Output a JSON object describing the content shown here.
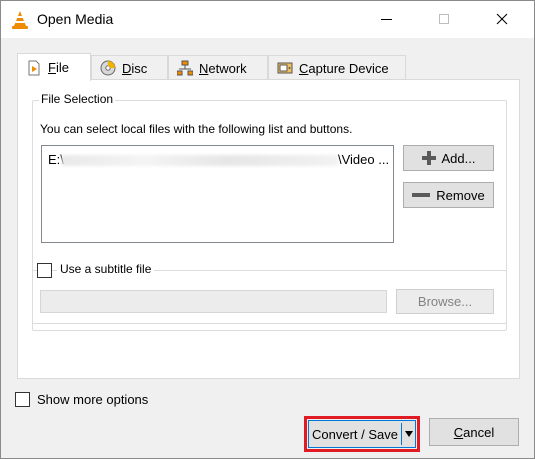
{
  "window": {
    "title": "Open Media"
  },
  "tabs": [
    {
      "label": "File",
      "icon": "file-play-icon",
      "active": true
    },
    {
      "label": "Disc",
      "icon": "disc-icon",
      "active": false
    },
    {
      "label": "Network",
      "icon": "network-icon",
      "active": false
    },
    {
      "label": "Capture Device",
      "icon": "capture-device-icon",
      "active": false
    }
  ],
  "file_selection": {
    "title": "File Selection",
    "description": "You can select local files with the following list and buttons.",
    "files": [
      {
        "prefix": "E:\\",
        "suffix": "\\Video ..."
      }
    ],
    "add_label": "Add...",
    "remove_label": "Remove"
  },
  "subtitle": {
    "label": "Use a subtitle file",
    "checked": false,
    "path_value": "",
    "browse_label": "Browse..."
  },
  "options": {
    "show_more_label": "Show more options",
    "checked": false
  },
  "footer": {
    "convert_label": "Convert / Save",
    "cancel_label": "Cancel"
  },
  "colors": {
    "highlight": "#e01b24",
    "focus_border": "#0078d7",
    "vlc_orange": "#f08a00"
  }
}
